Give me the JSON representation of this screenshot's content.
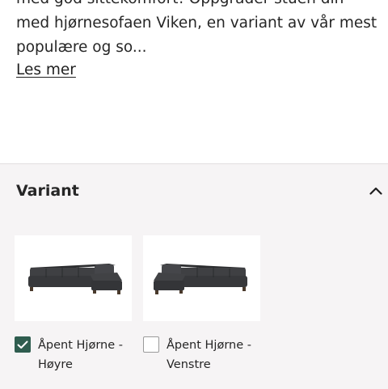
{
  "description": {
    "line1": "med god sittekomfort! Oppgrader stuen din",
    "line2": "med hjørnesofaen Viken, en variant av vår mest",
    "line3": "populære og so...",
    "read_more": "Les mer"
  },
  "variant_panel": {
    "title": "Variant",
    "expanded": true,
    "options": [
      {
        "label": "Åpent Hjørne - Høyre",
        "checked": true
      },
      {
        "label": "Åpent Hjørne - Venstre",
        "checked": false
      }
    ]
  },
  "colors": {
    "accent": "#2f5d4f",
    "panel_bg": "#f6f4f5",
    "sofa": "#3a3b3d"
  },
  "icons": {
    "collapse": "chevron-up-icon",
    "check": "check-icon"
  }
}
